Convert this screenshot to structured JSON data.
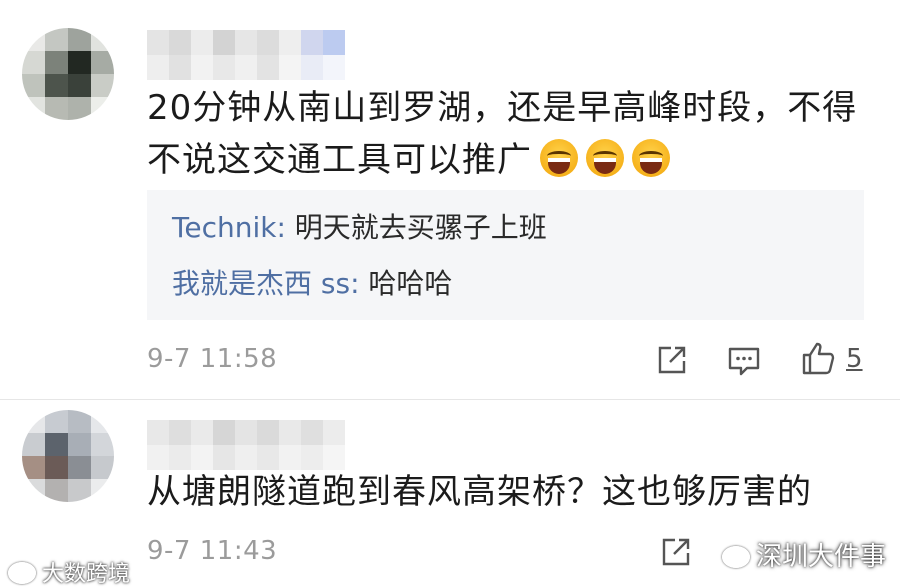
{
  "comments": [
    {
      "body": "20分钟从南山到罗湖，还是早高峰时段，不得不说这交通工具可以推广",
      "emoji_icon": "laughing-emoji",
      "emoji_count": 3,
      "replies": [
        {
          "author": "Technik:",
          "text": "明天就去买骡子上班"
        },
        {
          "author": "我就是杰西 ss:",
          "text": "哈哈哈"
        }
      ],
      "time": "9-7 11:58",
      "like_count": "5",
      "actions": [
        "share-icon",
        "reply-icon",
        "like-icon"
      ]
    },
    {
      "body": "从塘朗隧道跑到春风高架桥？这也够厉害的",
      "time": "9-7 11:43",
      "actions": [
        "share-icon"
      ]
    }
  ],
  "watermarks": {
    "left": "大数跨境",
    "right": "深圳大件事"
  },
  "colors": {
    "reply_author": "#4f6fa3",
    "reply_bg": "#f5f6f8",
    "meta": "#9b9b9b",
    "emoji": "#f6b21c"
  }
}
